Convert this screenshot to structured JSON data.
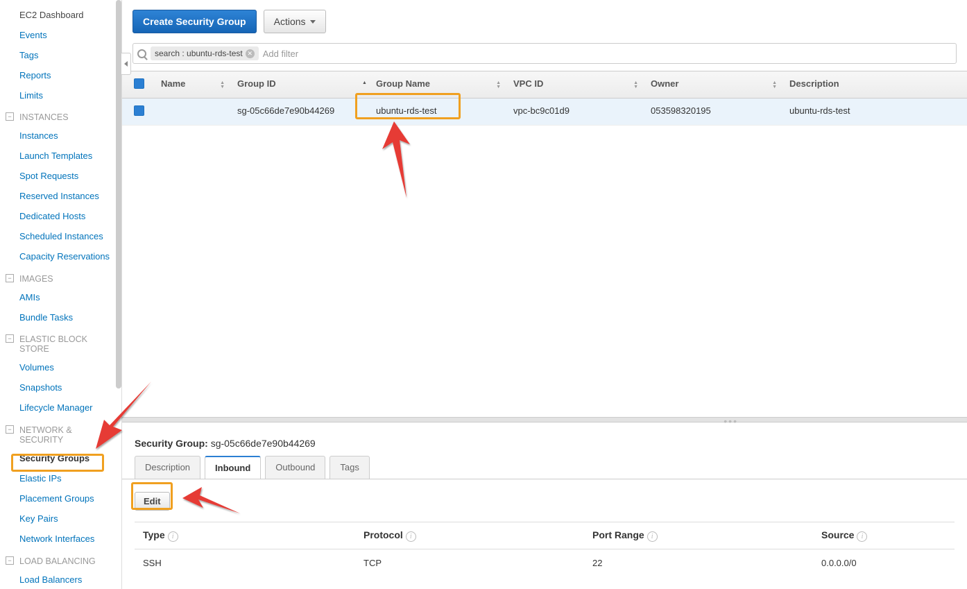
{
  "sidebar": {
    "top_items": [
      "EC2 Dashboard",
      "Events",
      "Tags",
      "Reports",
      "Limits"
    ],
    "sections": [
      {
        "title": "INSTANCES",
        "items": [
          "Instances",
          "Launch Templates",
          "Spot Requests",
          "Reserved Instances",
          "Dedicated Hosts",
          "Scheduled Instances",
          "Capacity Reservations"
        ]
      },
      {
        "title": "IMAGES",
        "items": [
          "AMIs",
          "Bundle Tasks"
        ]
      },
      {
        "title": "ELASTIC BLOCK STORE",
        "items": [
          "Volumes",
          "Snapshots",
          "Lifecycle Manager"
        ]
      },
      {
        "title": "NETWORK & SECURITY",
        "items": [
          "Security Groups",
          "Elastic IPs",
          "Placement Groups",
          "Key Pairs",
          "Network Interfaces"
        ],
        "selected": 0
      },
      {
        "title": "LOAD BALANCING",
        "items": [
          "Load Balancers"
        ]
      }
    ]
  },
  "toolbar": {
    "create": "Create Security Group",
    "actions": "Actions"
  },
  "filter": {
    "chip": "search : ubuntu-rds-test",
    "placeholder": "Add filter"
  },
  "columns": [
    "Name",
    "Group ID",
    "Group Name",
    "VPC ID",
    "Owner",
    "Description"
  ],
  "rows": [
    {
      "name": "",
      "group_id": "sg-05c66de7e90b44269",
      "group_name": "ubuntu-rds-test",
      "vpc_id": "vpc-bc9c01d9",
      "owner": "053598320195",
      "description": "ubuntu-rds-test"
    }
  ],
  "details": {
    "title_label": "Security Group:",
    "title_value": "sg-05c66de7e90b44269",
    "tabs": [
      "Description",
      "Inbound",
      "Outbound",
      "Tags"
    ],
    "active_tab": 1,
    "edit": "Edit",
    "rule_headers": [
      "Type",
      "Protocol",
      "Port Range",
      "Source"
    ],
    "rules": [
      {
        "type": "SSH",
        "protocol": "TCP",
        "port": "22",
        "source": "0.0.0.0/0"
      }
    ]
  }
}
